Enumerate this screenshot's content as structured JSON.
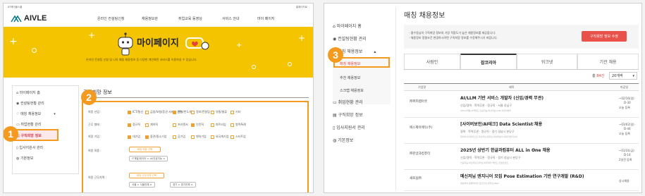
{
  "left": {
    "top_bar": {
      "brand_small": "KT에이블스쿨",
      "right_link": "홈페이지로"
    },
    "logo": "AIVLE",
    "nav": [
      "온라인 컨설팅신청",
      "채용정보관",
      "취업교육 동영상",
      "서비스 안내",
      "마이 페이지"
    ],
    "banner": {
      "title": "마이페이지",
      "subtitle": "온라인 컨설팅 신청 및 나의 매칭 채용정보 등 다양한 개인화된 서비스를 이용하실 수 있습니다."
    },
    "sidebar": [
      "마이페이지 홈",
      "컨설팅현황 관리",
      "매칭 채용정보",
      "취업현황 관리",
      "구직희망 정보",
      "입사지원서 관리",
      "기본정보"
    ],
    "section_title": "구직희망 정보",
    "form": {
      "rows": [
        {
          "label": "희망 산업 :",
          "options": [
            "ICT/통신",
            "금융/보험/증권 서비스 관련",
            "전자/반도체",
            "정보/컨설팅",
            "유통/물류",
            "기타"
          ],
          "checked": [
            0,
            2
          ]
        },
        {
          "label": "근무 형태 :",
          "options": [
            "정규직",
            "계약직",
            "프리랜서",
            "인턴직",
            "파트타임",
            "병역특례"
          ],
          "checked": [
            0,
            3
          ]
        },
        {
          "label": "희망 기업 :",
          "options": [
            "대기업",
            "중견/중소기업",
            "공기업",
            "벤처기업",
            "외국계기업",
            "스타트업"
          ],
          "checked": [
            0,
            1
          ]
        }
      ],
      "job_label": "희망 직종 :",
      "job_button": "희망 직종 선택",
      "job_chip": "IT개발/데이터 > AI/인공지능 ×",
      "region_label": "희망 근무지역 :",
      "region_button": "희망 근무지역 선택",
      "region_chips": [
        "서울 > 서울전체 ×",
        "경기 > 경기전체 ×"
      ]
    },
    "callouts": [
      "1",
      "2"
    ]
  },
  "right": {
    "sidebar": [
      "마이페이지 홈",
      "컨설팅현황 관리",
      "매칭 채용정보",
      "매칭 채용정보",
      "추천 채용정보",
      "스크랩 채용정보",
      "취업현황 관리",
      "구직희망 정보",
      "입사지원서 관리",
      "기본정보"
    ],
    "page_title": "매칭 채용정보",
    "notice": [
      "- 졸수동님의 구직희망 정보와 가장 적합도가 높은 채용정보를 제공합니다.",
      "- 채용정보 정렬조건 변경하시려면 구직희망 정보를 수정해주시기 바랍니다."
    ],
    "edit_button": "구직희망 정보 수정",
    "tabs": [
      "사람인",
      "잡코리아",
      "워크넷",
      "기관 채용"
    ],
    "total_prefix": "총",
    "total_count": "84건",
    "per_page": "20개씩",
    "table_headers": [
      "기업명",
      "제목",
      "마감일"
    ],
    "jobs": [
      {
        "company": "㈜퍼피랩아웃",
        "title": "AI/LLM 기반 서비스 개발자 (신입/경력 무관)",
        "meta": "신입/경력 · 학력무관 · 정규직 · 서울 강남구",
        "tags": "SW/AI개발,AI백엔드,인공지능,머신러닝,LLM,자연어처리",
        "date": "~02/16(일)",
        "dday": "D-30",
        "update": "오늘 등록"
      },
      {
        "company": "에스제이에듀(주)",
        "title": "[사이버보안/AI테크] Data Scientist 채용",
        "meta": "경력 · 학력무관 · 정규직 · 경기 성남시 분당구",
        "tags": "데이터사이언티스트,머신러닝,딥러닝,데이터분석,데이터엔지니어",
        "date": "~03/02(일)",
        "dday": "D-44",
        "update": "오늘 등록"
      },
      {
        "company": "㈜한글과컴퓨터",
        "title": "2025년 상반기 한글과컴퓨터 ALL in One 채용",
        "meta": "신입/경력 · 학력무관 · 정규직 · 경기 성남시 분당구",
        "tags": "인공지능,머신러닝,딥러닝,빅데이터,백엔드,프론트엔드",
        "date": "~01/31(금)",
        "dday": "D-14",
        "update": "2일전 등록"
      },
      {
        "company": "새로움㈜",
        "title": "메신저님 엔지니어 모집 Pose Estimation 기반 연구개발 (R&D)",
        "meta": "",
        "tags": "영상처리,컴퓨터비전,포즈추정,딥러닝,R&D",
        "date": "",
        "dday": "",
        "update": "상시채용"
      }
    ],
    "callout": "3"
  },
  "colors": {
    "accent": "#f39a1f",
    "banner": "#f5c400",
    "danger": "#e8524a",
    "highlight": "#e2453c"
  }
}
